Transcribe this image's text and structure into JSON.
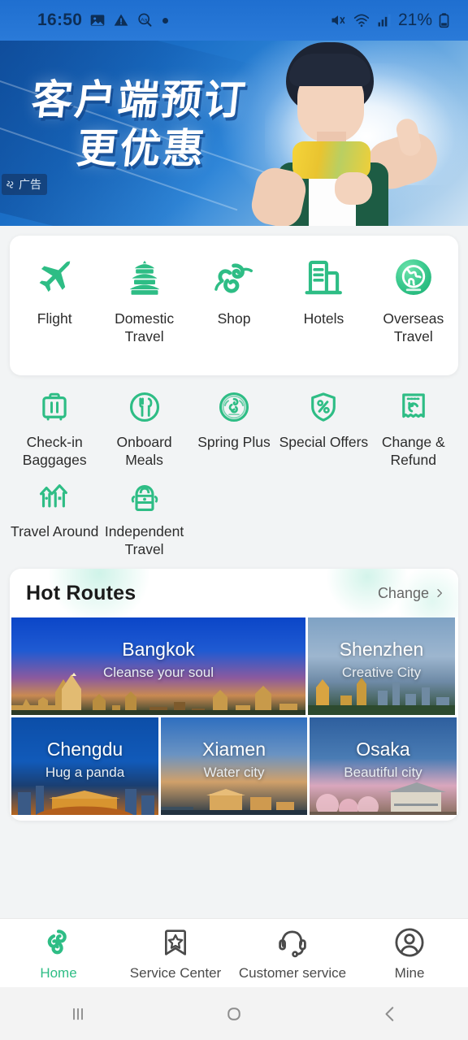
{
  "status_bar": {
    "time": "16:50",
    "battery_percent": "21%",
    "icons": [
      "image-icon",
      "warning-icon",
      "text-search-icon",
      "dot-icon",
      "mute-icon",
      "wifi-icon",
      "signal-icon",
      "battery-icon"
    ]
  },
  "banner": {
    "headline_line1": "客户端预订",
    "headline_line2": "更优惠",
    "ad_label": "广告",
    "ad_icon": "ad-badge-icon"
  },
  "quick_actions": [
    {
      "label": "Flight",
      "icon": "airplane-icon"
    },
    {
      "label": "Domestic Travel",
      "icon": "pagoda-icon"
    },
    {
      "label": "Shop",
      "icon": "cloud-swirl-icon"
    },
    {
      "label": "Hotels",
      "icon": "building-icon"
    },
    {
      "label": "Overseas Travel",
      "icon": "globe-icon"
    }
  ],
  "services_row1": [
    {
      "label": "Check-in Baggages",
      "icon": "suitcase-icon"
    },
    {
      "label": "Onboard Meals",
      "icon": "cutlery-circle-icon"
    },
    {
      "label": "Spring Plus",
      "icon": "spring-seal-icon"
    },
    {
      "label": "Special Offers",
      "icon": "percent-tag-icon"
    },
    {
      "label": "Change & Refund",
      "icon": "receipt-refund-icon"
    }
  ],
  "services_row2": [
    {
      "label": "Travel Around",
      "icon": "houses-icon"
    },
    {
      "label": "Independent Travel",
      "icon": "backpack-icon"
    }
  ],
  "hot_routes": {
    "title": "Hot Routes",
    "change_label": "Change",
    "change_icon": "chevron-right-icon",
    "tiles": [
      {
        "city": "Bangkok",
        "tagline": "Cleanse your soul"
      },
      {
        "city": "Shenzhen",
        "tagline": "Creative City"
      },
      {
        "city": "Chengdu",
        "tagline": "Hug a panda"
      },
      {
        "city": "Xiamen",
        "tagline": "Water city"
      },
      {
        "city": "Osaka",
        "tagline": "Beautiful city"
      }
    ]
  },
  "tab_bar": [
    {
      "label": "Home",
      "icon": "spring-logo-icon",
      "active": true
    },
    {
      "label": "Service Center",
      "icon": "bookmark-star-icon",
      "active": false
    },
    {
      "label": "Customer service",
      "icon": "headset-icon",
      "active": false
    },
    {
      "label": "Mine",
      "icon": "person-circle-icon",
      "active": false
    }
  ],
  "system_nav": [
    {
      "icon": "recents-icon"
    },
    {
      "icon": "home-circle-icon"
    },
    {
      "icon": "back-chevron-icon"
    }
  ],
  "colors": {
    "accent_green": "#2EBD85",
    "banner_blue": "#1f6fd0",
    "page_bg": "#F2F4F5",
    "card_bg": "#FFFFFF",
    "text_primary": "#2C2C2C",
    "text_muted": "#666666"
  }
}
